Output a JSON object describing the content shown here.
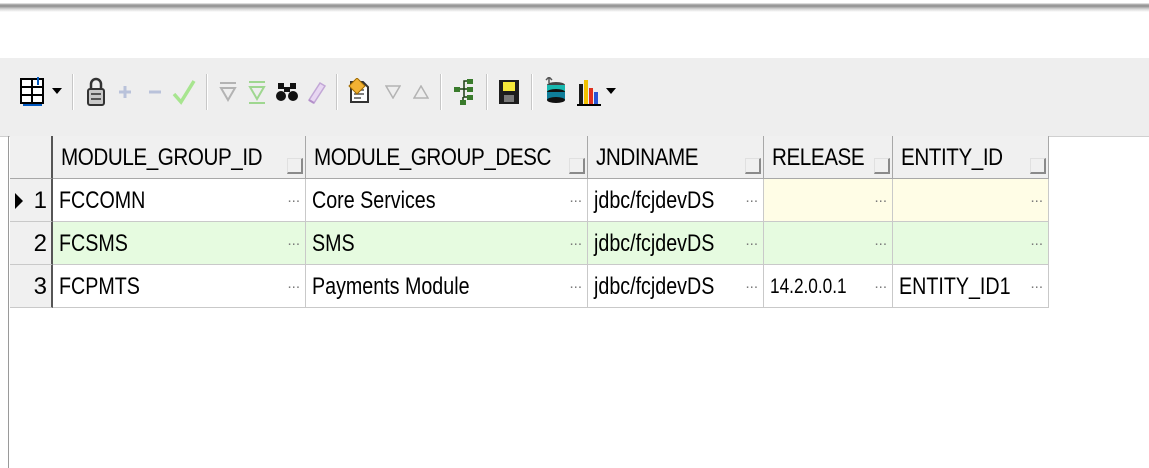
{
  "toolbar": {
    "icons": [
      "grid-layout-icon",
      "dropdown-arrow-icon",
      "lock-icon",
      "insert-row-icon",
      "delete-row-icon",
      "post-changes-check-icon",
      "filter-icon",
      "clear-filter-icon",
      "find-binoculars-icon",
      "clear-eraser-icon",
      "query-by-example-icon",
      "sort-descending-icon",
      "sort-ascending-icon",
      "tree-structure-icon",
      "save-disk-icon",
      "export-database-icon",
      "chart-icon",
      "dropdown-arrow-icon"
    ]
  },
  "grid": {
    "columns": [
      "MODULE_GROUP_ID",
      "MODULE_GROUP_DESC",
      "JNDINAME",
      "RELEASE",
      "ENTITY_ID"
    ],
    "rows": [
      {
        "num": "1",
        "cells": [
          "FCCOMN",
          "Core Services",
          "jdbc/fcjdevDS",
          "",
          ""
        ]
      },
      {
        "num": "2",
        "cells": [
          "FCSMS",
          "SMS",
          "jdbc/fcjdevDS",
          "",
          ""
        ]
      },
      {
        "num": "3",
        "cells": [
          "FCPMTS",
          "Payments Module",
          "jdbc/fcjdevDS",
          "14.2.0.0.1",
          "ENTITY_ID1"
        ]
      }
    ],
    "current_row": "1",
    "ellipsis": "..."
  },
  "colors": {
    "selected_row_bg": "#ffffff",
    "selected_empty_cell_bg": "#fffde6",
    "alt_row_bg": "#e6fbe0",
    "header_bg": "#f0f0f0"
  }
}
